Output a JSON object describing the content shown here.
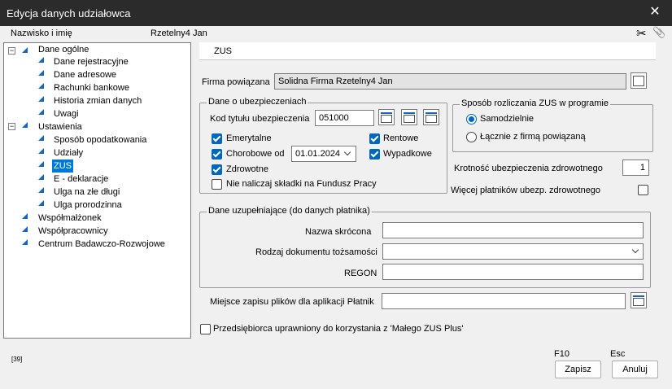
{
  "window": {
    "title": "Edycja danych udziałowca",
    "close_glyph": "✕"
  },
  "header": {
    "name_label": "Nazwisko i imię",
    "name_value": "Rzetelny4 Jan",
    "scissors_glyph": "✂",
    "clip_glyph": "📎"
  },
  "tree": {
    "items": [
      {
        "label": "Dane ogólne",
        "expander": "−"
      },
      {
        "label": "Dane rejestracyjne"
      },
      {
        "label": "Dane adresowe"
      },
      {
        "label": "Rachunki bankowe"
      },
      {
        "label": "Historia zmian danych"
      },
      {
        "label": "Uwagi"
      },
      {
        "label": "Ustawienia",
        "expander": "−"
      },
      {
        "label": "Sposób opodatkowania"
      },
      {
        "label": "Udziały"
      },
      {
        "label": "ZUS",
        "selected": true
      },
      {
        "label": "E - deklaracje"
      },
      {
        "label": "Ulga na złe długi"
      },
      {
        "label": "Ulga prorodzinna"
      },
      {
        "label": "Współmałżonek"
      },
      {
        "label": "Współpracownicy"
      },
      {
        "label": "Centrum Badawczo-Rozwojowe"
      }
    ]
  },
  "section_title": "ZUS",
  "firma": {
    "label": "Firma powiązana",
    "value": "Solidna Firma Rzetelny4 Jan"
  },
  "ubezp": {
    "legend": "Dane o ubezpieczeniach",
    "kod_label": "Kod tytułu ubezpieczenia",
    "kod_value": "051000",
    "emerytalne": "Emerytalne",
    "rentowe": "Rentowe",
    "chorobowe": "Chorobowe od",
    "chorobowe_date": "01.01.2024",
    "wypadkowe": "Wypadkowe",
    "zdrowotne": "Zdrowotne",
    "nie_naliczaj": "Nie naliczaj składki na Fundusz Pracy"
  },
  "sposob": {
    "legend": "Sposób rozliczania ZUS w programie",
    "opt1": "Samodzielnie",
    "opt2": "Łącznie z firmą powiązaną"
  },
  "krotnosc": {
    "label": "Krotność ubezpieczenia zdrowotnego",
    "value": "1"
  },
  "wiecej": {
    "label": "Więcej płatników ubezp. zdrowotnego"
  },
  "uzup": {
    "legend": "Dane uzupełniające (do danych płatnika)",
    "nazwa_label": "Nazwa skrócona",
    "nazwa_value": "",
    "rodzaj_label": "Rodzaj dokumentu tożsamości",
    "rodzaj_value": "",
    "regon_label": "REGON",
    "regon_value": ""
  },
  "miejsce": {
    "label": "Miejsce zapisu plików dla aplikacji Płatnik",
    "value": ""
  },
  "maly_zus": {
    "label": "Przedsiębiorca uprawniony do korzystania z 'Małego ZUS Plus'"
  },
  "footer": {
    "code": "[39]",
    "save_key": "F10",
    "save_label": "Zapisz",
    "cancel_key": "Esc",
    "cancel_label": "Anuluj"
  },
  "colors": {
    "accent": "#0067c0",
    "title_bar": "#2b2b2b",
    "selection": "#0078d7",
    "tree_triangle": "#1565c0"
  }
}
